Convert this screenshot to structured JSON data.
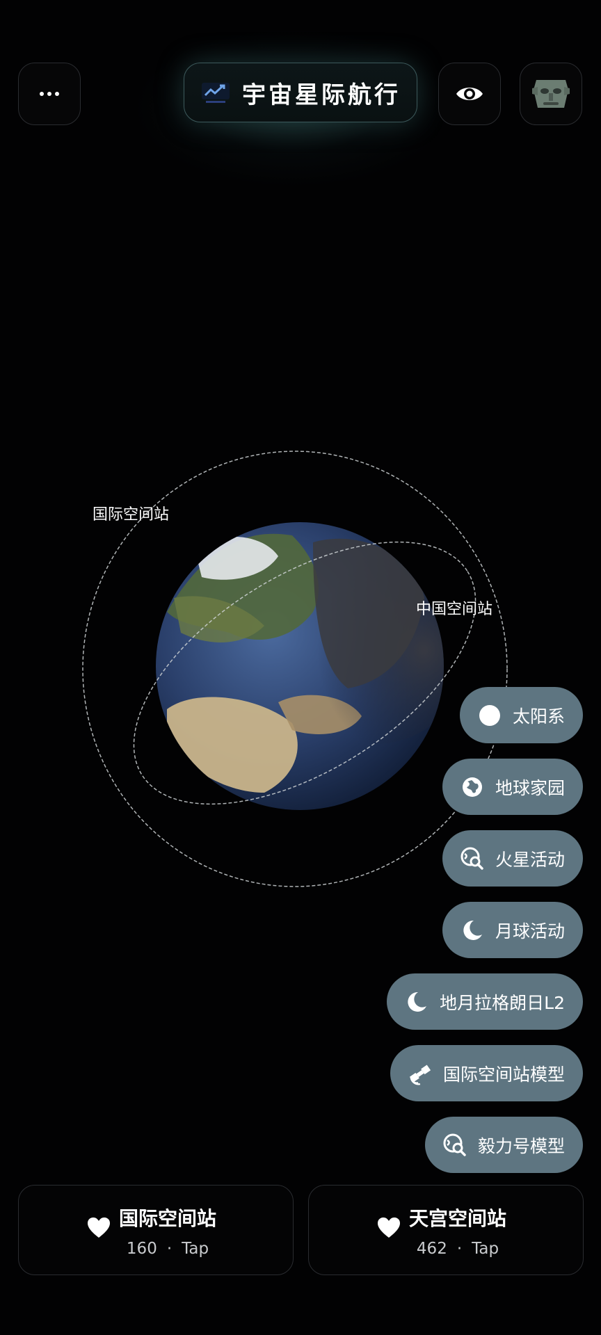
{
  "header": {
    "title": "宇宙星际航行",
    "menu_icon": "more-dots-icon",
    "eye_icon": "eye-icon",
    "avatar_icon": "avatar-mask"
  },
  "orbits": {
    "iss_label": "国际空间站",
    "css_label": "中国空间站"
  },
  "menu": [
    {
      "label": "太阳系",
      "icon": "sun-icon"
    },
    {
      "label": "地球家园",
      "icon": "globe-icon"
    },
    {
      "label": "火星活动",
      "icon": "globe-search-icon"
    },
    {
      "label": "月球活动",
      "icon": "moon-icon"
    },
    {
      "label": "地月拉格朗日L2",
      "icon": "moon-icon"
    },
    {
      "label": "国际空间站模型",
      "icon": "satellite-icon"
    },
    {
      "label": "毅力号模型",
      "icon": "globe-search-icon"
    }
  ],
  "cards": [
    {
      "title": "国际空间站",
      "count": "160",
      "sep": "·",
      "action": "Tap"
    },
    {
      "title": "天宫空间站",
      "count": "462",
      "sep": "·",
      "action": "Tap"
    }
  ],
  "colors": {
    "pill_bg": "#5e7581",
    "title_border": "#3d5a5c",
    "background": "#020203"
  }
}
